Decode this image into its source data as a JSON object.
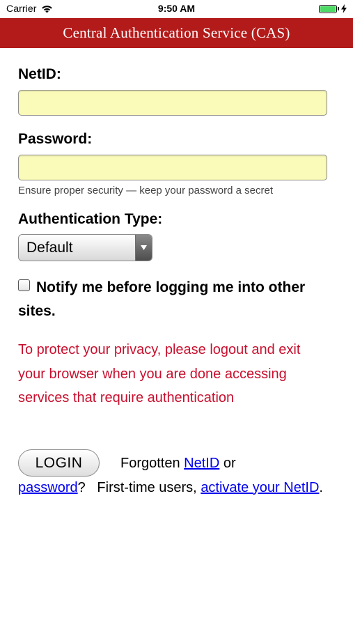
{
  "status_bar": {
    "carrier": "Carrier",
    "time": "9:50 AM",
    "battery_color": "#4cd964"
  },
  "header": {
    "title": "Central Authentication Service (CAS)",
    "color": "#b31b1b"
  },
  "form": {
    "netid_label": "NetID:",
    "netid_value": "",
    "password_label": "Password:",
    "password_value": "",
    "password_hint": "Ensure proper security — keep your password a secret",
    "auth_type_label": "Authentication Type:",
    "auth_type_selected": "Default",
    "notify_label": "Notify me before logging me into other sites.",
    "notify_checked": false,
    "privacy_note": "To protect your privacy, please logout and exit your browser when you are done accessing services that require authentication",
    "privacy_color": "#c8102e",
    "login_button": "LOGIN"
  },
  "help": {
    "forgotten_prefix": "Forgotten",
    "netid_link": "NetID",
    "or_text": "or",
    "password_link": "password",
    "first_time_text": "?   First-time users,",
    "activate_link": "activate your NetID",
    "end_period": "."
  },
  "icons": {
    "wifi": "wifi-icon",
    "battery": "battery-icon",
    "charging": "charging-bolt-icon",
    "select_arrow": "chevron-down-icon"
  }
}
